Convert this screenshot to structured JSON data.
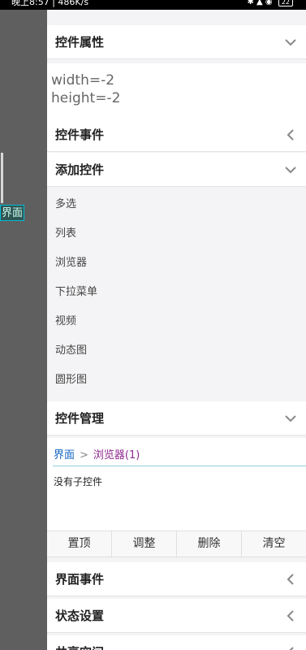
{
  "status_bar": {
    "time_text": "晚上8:57 | 486K/s",
    "icons": "✱ ▲ ◉",
    "battery": "22"
  },
  "left_pane": {
    "view_tag": "界面"
  },
  "sections": {
    "properties": {
      "title": "控件属性",
      "state": "expanded"
    },
    "events": {
      "title": "控件事件",
      "state": "collapsed"
    },
    "add_control": {
      "title": "添加控件",
      "state": "expanded"
    },
    "management": {
      "title": "控件管理",
      "state": "expanded"
    },
    "view_events": {
      "title": "界面事件",
      "state": "collapsed"
    },
    "state_settings": {
      "title": "状态设置",
      "state": "collapsed"
    },
    "shared_space": {
      "title": "共享空间",
      "state": "collapsed"
    }
  },
  "properties": {
    "lines": [
      "width=-2",
      "height=-2"
    ]
  },
  "add_control_items": [
    "多选",
    "列表",
    "浏览器",
    "下拉菜单",
    "视频",
    "动态图",
    "圆形图"
  ],
  "management": {
    "breadcrumb_root": "界面",
    "breadcrumb_sep": ">",
    "breadcrumb_current": "浏览器(1)",
    "empty_text": "没有子控件"
  },
  "action_buttons": [
    "置顶",
    "调整",
    "删除",
    "清空"
  ],
  "colors": {
    "accent_link": "#1565c0",
    "breadcrumb_current": "#8e2a8f",
    "underline": "#8fd2da"
  },
  "icons": {
    "expanded": "chevron-down-icon",
    "collapsed": "chevron-left-icon"
  }
}
